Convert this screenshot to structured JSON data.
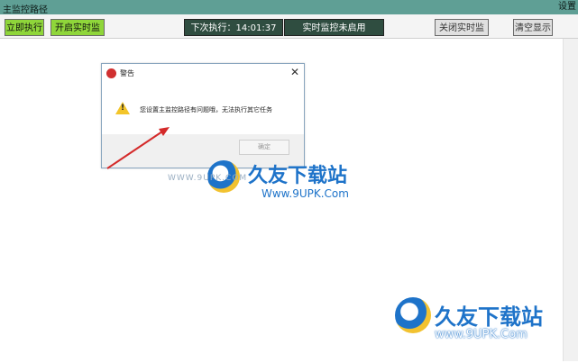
{
  "window": {
    "title": "主监控路径",
    "settings_label": "设置"
  },
  "toolbar": {
    "run_now": "立即执行",
    "start_monitor": "开启实时监控",
    "next_run": "下次执行：14:01:37",
    "monitor_status": "实时监控未启用",
    "stop_monitor": "关闭实时监控",
    "clear_display": "清空显示"
  },
  "dialog": {
    "title": "警告",
    "message": "您设置主监控路径有问题哦，无法执行其它任务",
    "ok_label": "确定"
  },
  "watermark": {
    "brand": "久友下载站",
    "url": "Www.9UPK.Com",
    "url_faint": "WWW.9UPK.COM",
    "corner_url": "www.9UPK.Com"
  },
  "colors": {
    "titlebar": "#5f9f95",
    "button_green": "#8fd63a",
    "status_dark": "#2f4d40",
    "watermark_blue": "#1e73c9",
    "arrow_red": "#d42a2a"
  }
}
